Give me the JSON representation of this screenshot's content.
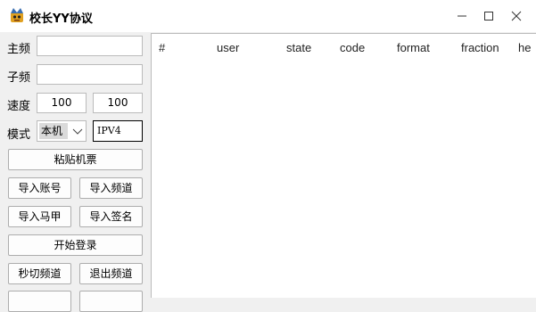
{
  "window": {
    "title": "校长YY协议",
    "icon": "app-logo-icon",
    "controls": [
      "minimize-icon",
      "maximize-icon",
      "close-icon"
    ]
  },
  "form": {
    "main_channel_label": "主频",
    "main_channel_value": "",
    "sub_channel_label": "子频",
    "sub_channel_value": "",
    "speed_label": "速度",
    "speed_value_1": "100",
    "speed_value_2": "100",
    "mode_label": "模式",
    "mode_selected": "本机",
    "ip_value": "IPV4"
  },
  "buttons": {
    "paste_ticket": "粘贴机票",
    "import_accounts": "导入账号",
    "import_channel": "导入频道",
    "import_vest": "导入马甲",
    "import_signature": "导入签名",
    "start_login": "开始登录",
    "quick_switch": "秒切频道",
    "exit_channel": "退出频道"
  },
  "table": {
    "columns": [
      "#",
      "user",
      "state",
      "code",
      "format",
      "fraction",
      "he"
    ],
    "rows": []
  }
}
